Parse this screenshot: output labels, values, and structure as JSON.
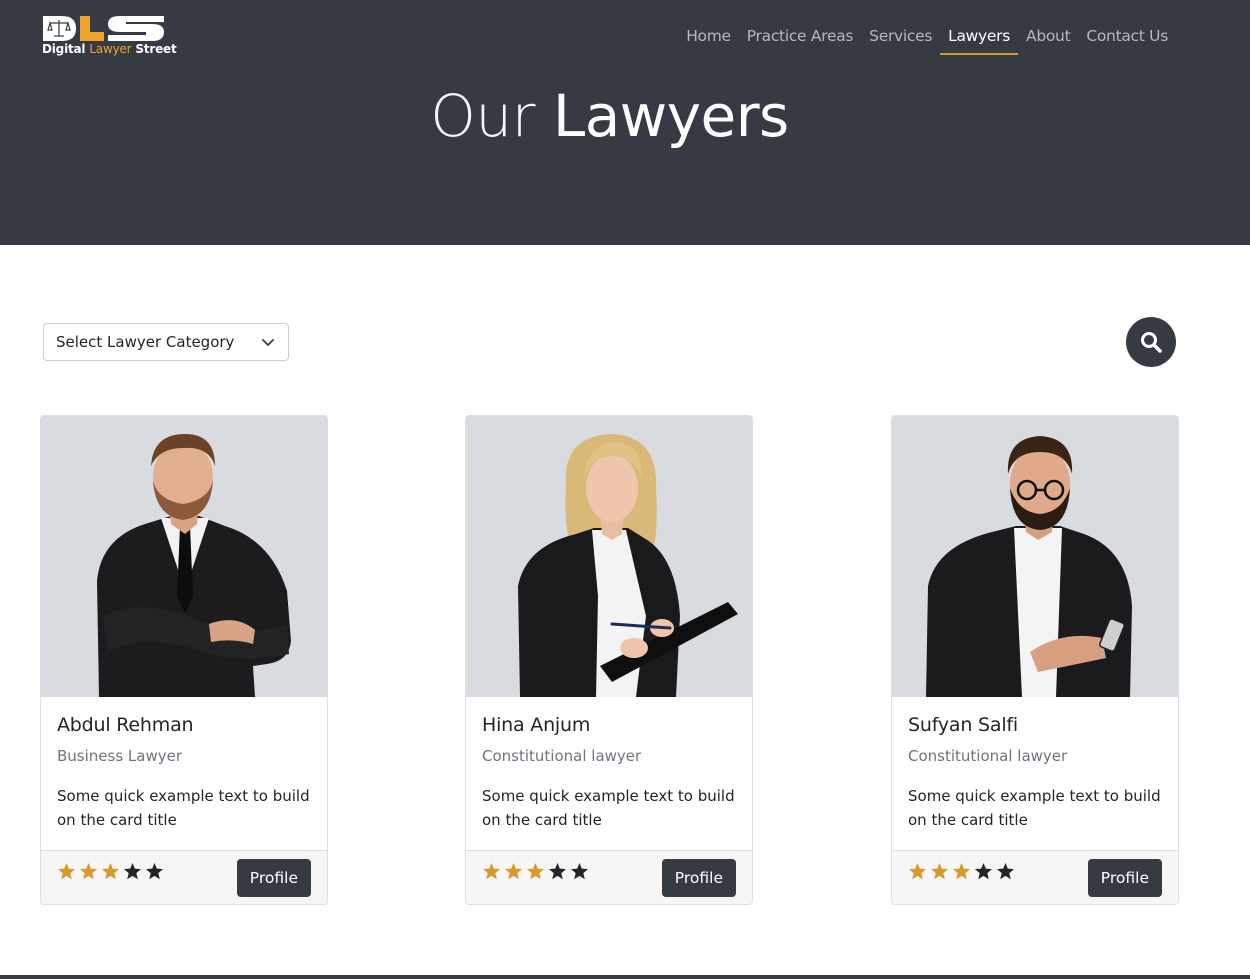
{
  "brand": {
    "mark": "DLS",
    "name_part1": "Digital ",
    "name_part2": "Lawyer",
    "name_part3": " Street",
    "accent_color": "#f0a32a"
  },
  "nav": {
    "items": [
      {
        "label": "Home"
      },
      {
        "label": "Practice Areas"
      },
      {
        "label": "Services"
      },
      {
        "label": "Lawyers",
        "active": true
      },
      {
        "label": "About"
      },
      {
        "label": "Contact Us"
      }
    ]
  },
  "hero": {
    "title_light": "Our",
    "title_bold": "Lawyers",
    "background_color": "#363a42"
  },
  "filter": {
    "selected": "Select Lawyer Category",
    "search_icon": "search-icon"
  },
  "lawyers": [
    {
      "name": "Abdul Rehman",
      "category": "Business Lawyer",
      "text": "Some quick example text to build on the card title",
      "rating": 3,
      "rating_max": 5,
      "button": "Profile"
    },
    {
      "name": "Hina Anjum",
      "category": "Constitutional lawyer",
      "text": "Some quick example text to build on the card title",
      "rating": 3,
      "rating_max": 5,
      "button": "Profile"
    },
    {
      "name": "Sufyan Salfi",
      "category": "Constitutional lawyer",
      "text": "Some quick example text to build on the card title",
      "rating": 3,
      "rating_max": 5,
      "button": "Profile"
    }
  ],
  "colors": {
    "star_on": "#d69a2a",
    "star_off": "#212529",
    "dark": "#363a42"
  }
}
